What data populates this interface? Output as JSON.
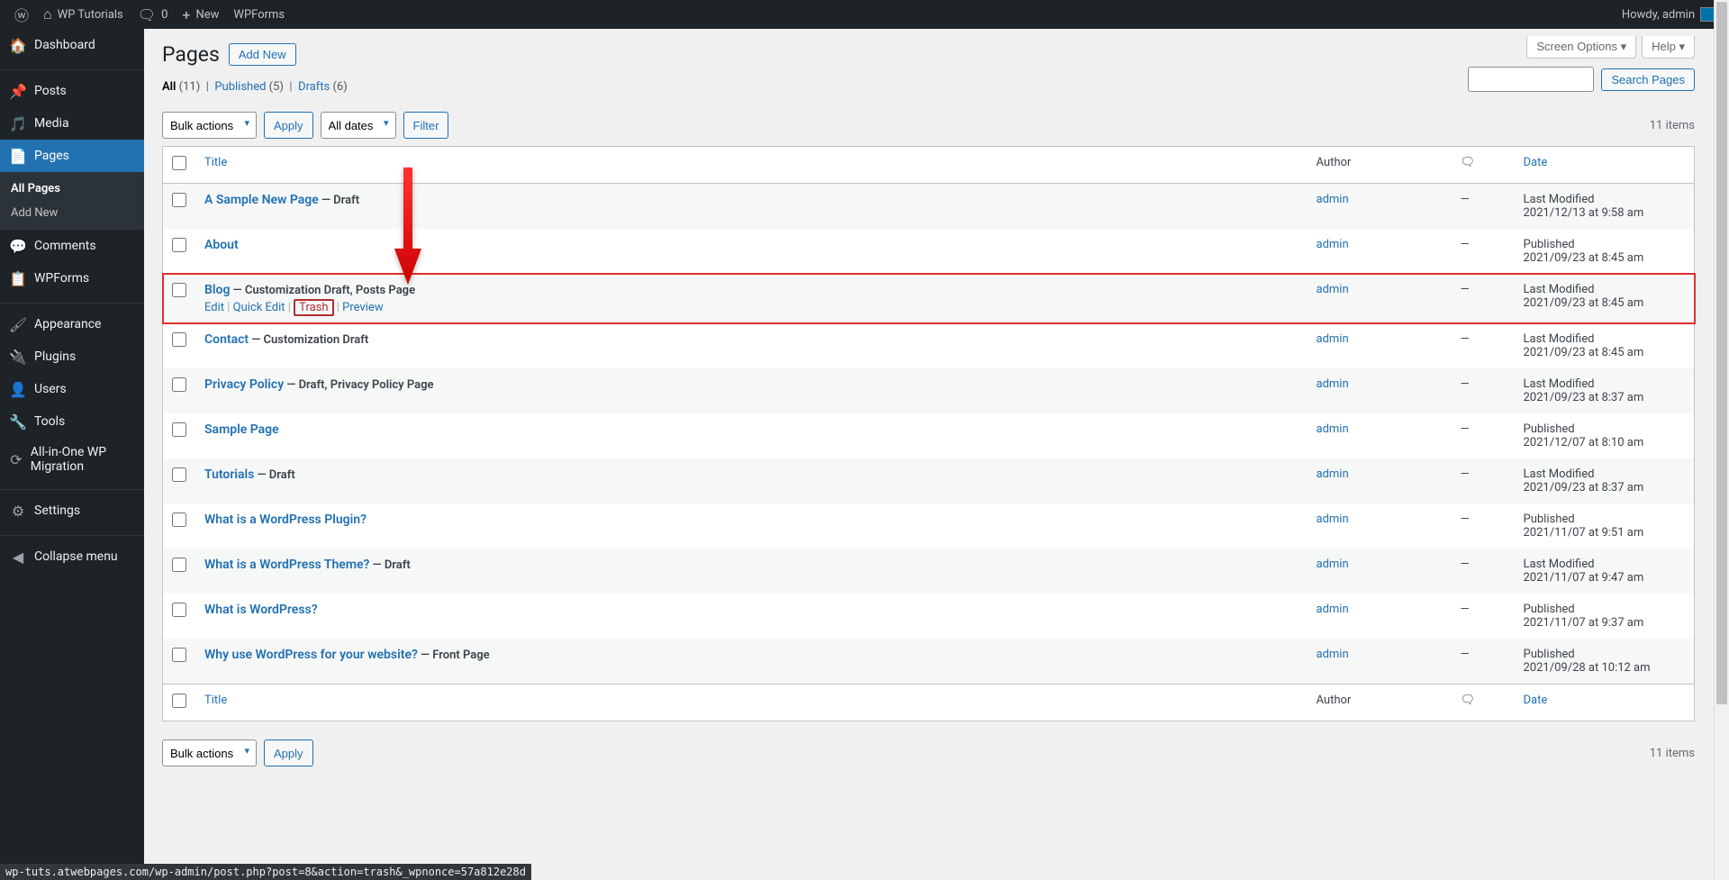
{
  "adminbar": {
    "site_name": "WP Tutorials",
    "comments_count": "0",
    "new_label": "New",
    "wpforms_label": "WPForms",
    "howdy": "Howdy, admin"
  },
  "sidebar": {
    "items": [
      {
        "icon": "speedometer",
        "label": "Dashboard"
      },
      {
        "icon": "pin",
        "label": "Posts"
      },
      {
        "icon": "media",
        "label": "Media"
      },
      {
        "icon": "page",
        "label": "Pages",
        "current": true
      },
      {
        "icon": "chat",
        "label": "Comments"
      },
      {
        "icon": "form",
        "label": "WPForms"
      },
      {
        "icon": "brush",
        "label": "Appearance"
      },
      {
        "icon": "plug",
        "label": "Plugins"
      },
      {
        "icon": "user",
        "label": "Users"
      },
      {
        "icon": "wrench",
        "label": "Tools"
      },
      {
        "icon": "migrate",
        "label": "All-in-One WP Migration"
      },
      {
        "icon": "sliders",
        "label": "Settings"
      },
      {
        "icon": "collapse",
        "label": "Collapse menu"
      }
    ],
    "sub": [
      {
        "label": "All Pages",
        "current": true
      },
      {
        "label": "Add New"
      }
    ]
  },
  "header": {
    "title": "Pages",
    "add_new": "Add New",
    "screen_options": "Screen Options",
    "help": "Help"
  },
  "filters": {
    "all": "All",
    "all_count": "(11)",
    "published": "Published",
    "published_count": "(5)",
    "drafts": "Drafts",
    "drafts_count": "(6)",
    "bulk": "Bulk actions",
    "apply": "Apply",
    "all_dates": "All dates",
    "filter": "Filter",
    "search": "Search Pages",
    "items_count": "11 items"
  },
  "columns": {
    "title": "Title",
    "author": "Author",
    "date": "Date"
  },
  "row_actions": {
    "edit": "Edit",
    "quick_edit": "Quick Edit",
    "trash": "Trash",
    "preview": "Preview"
  },
  "rows": [
    {
      "title": "A Sample New Page",
      "state": " — Draft",
      "author": "admin",
      "comments": "—",
      "date_status": "Last Modified",
      "date": "2021/12/13 at 9:58 am"
    },
    {
      "title": "About",
      "state": "",
      "author": "admin",
      "comments": "—",
      "date_status": "Published",
      "date": "2021/09/23 at 8:45 am"
    },
    {
      "title": "Blog",
      "state": " — Customization Draft, Posts Page",
      "author": "admin",
      "comments": "—",
      "date_status": "Last Modified",
      "date": "2021/09/23 at 8:45 am",
      "actions": true,
      "highlight": true
    },
    {
      "title": "Contact",
      "state": " — Customization Draft",
      "author": "admin",
      "comments": "—",
      "date_status": "Last Modified",
      "date": "2021/09/23 at 8:45 am"
    },
    {
      "title": "Privacy Policy",
      "state": " — Draft, Privacy Policy Page",
      "author": "admin",
      "comments": "—",
      "date_status": "Last Modified",
      "date": "2021/09/23 at 8:37 am"
    },
    {
      "title": "Sample Page",
      "state": "",
      "author": "admin",
      "comments": "—",
      "date_status": "Published",
      "date": "2021/12/07 at 8:10 am"
    },
    {
      "title": "Tutorials",
      "state": " — Draft",
      "author": "admin",
      "comments": "—",
      "date_status": "Last Modified",
      "date": "2021/09/23 at 8:37 am"
    },
    {
      "title": "What is a WordPress Plugin?",
      "state": "",
      "author": "admin",
      "comments": "—",
      "date_status": "Published",
      "date": "2021/11/07 at 9:51 am"
    },
    {
      "title": "What is a WordPress Theme?",
      "state": " — Draft",
      "author": "admin",
      "comments": "—",
      "date_status": "Last Modified",
      "date": "2021/11/07 at 9:47 am"
    },
    {
      "title": "What is WordPress?",
      "state": "",
      "author": "admin",
      "comments": "—",
      "date_status": "Published",
      "date": "2021/11/07 at 9:37 am"
    },
    {
      "title": "Why use WordPress for your website?",
      "state": " — Front Page",
      "author": "admin",
      "comments": "—",
      "date_status": "Published",
      "date": "2021/09/28 at 10:12 am"
    }
  ],
  "status_url": "wp-tuts.atwebpages.com/wp-admin/post.php?post=8&action=trash&_wpnonce=57a812e28d"
}
